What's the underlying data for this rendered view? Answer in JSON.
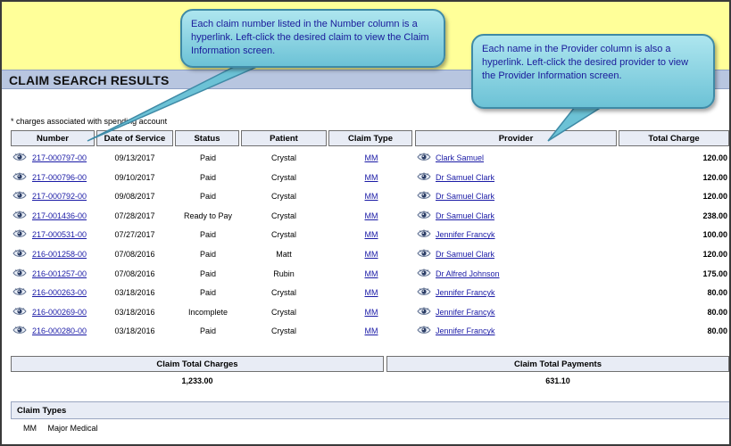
{
  "title": "CLAIM SEARCH RESULTS",
  "note": "* charges associated with spending account",
  "columns": [
    "Number",
    "Date of Service",
    "Status",
    "Patient",
    "Claim Type",
    "Provider",
    "Total Charge"
  ],
  "rows": [
    {
      "number": "217-000797-00",
      "date": "09/13/2017",
      "status": "Paid",
      "patient": "Crystal",
      "type": "MM",
      "provider": "Clark Samuel",
      "charge": "120.00"
    },
    {
      "number": "217-000796-00",
      "date": "09/10/2017",
      "status": "Paid",
      "patient": "Crystal",
      "type": "MM",
      "provider": "Dr Samuel Clark",
      "charge": "120.00"
    },
    {
      "number": "217-000792-00",
      "date": "09/08/2017",
      "status": "Paid",
      "patient": "Crystal",
      "type": "MM",
      "provider": "Dr Samuel Clark",
      "charge": "120.00"
    },
    {
      "number": "217-001436-00",
      "date": "07/28/2017",
      "status": "Ready to Pay",
      "patient": "Crystal",
      "type": "MM",
      "provider": "Dr Samuel Clark",
      "charge": "238.00"
    },
    {
      "number": "217-000531-00",
      "date": "07/27/2017",
      "status": "Paid",
      "patient": "Crystal",
      "type": "MM",
      "provider": "Jennifer Francyk",
      "charge": "100.00"
    },
    {
      "number": "216-001258-00",
      "date": "07/08/2016",
      "status": "Paid",
      "patient": "Matt",
      "type": "MM",
      "provider": "Dr Samuel Clark",
      "charge": "120.00"
    },
    {
      "number": "216-001257-00",
      "date": "07/08/2016",
      "status": "Paid",
      "patient": "Rubin",
      "type": "MM",
      "provider": "Dr Alfred Johnson",
      "charge": "175.00"
    },
    {
      "number": "216-000263-00",
      "date": "03/18/2016",
      "status": "Paid",
      "patient": "Crystal",
      "type": "MM",
      "provider": "Jennifer Francyk",
      "charge": "80.00"
    },
    {
      "number": "216-000269-00",
      "date": "03/18/2016",
      "status": "Incomplete",
      "patient": "Crystal",
      "type": "MM",
      "provider": "Jennifer Francyk",
      "charge": "80.00"
    },
    {
      "number": "216-000280-00",
      "date": "03/18/2016",
      "status": "Paid",
      "patient": "Crystal",
      "type": "MM",
      "provider": "Jennifer Francyk",
      "charge": "80.00"
    }
  ],
  "totals": {
    "charges_label": "Claim Total Charges",
    "charges_value": "1,233.00",
    "payments_label": "Claim Total Payments",
    "payments_value": "631.10"
  },
  "claim_types": {
    "header": "Claim Types",
    "items": [
      {
        "code": "MM",
        "name": "Major Medical"
      }
    ]
  },
  "callouts": {
    "number_help": "Each claim number listed in the Number column is a hyperlink. Left-click the desired claim to view the Claim Information screen.",
    "provider_help": "Each name in the Provider column is also a hyperlink. Left-click the desired provider to view the Provider Information screen."
  },
  "icons": {
    "row_view": "eye-icon",
    "provider_view": "eye-icon"
  },
  "colors": {
    "link": "#1a1aa6",
    "title_bar": "#b8c6e0",
    "top_band": "#ffff99",
    "callout": "#8fd3e2"
  }
}
